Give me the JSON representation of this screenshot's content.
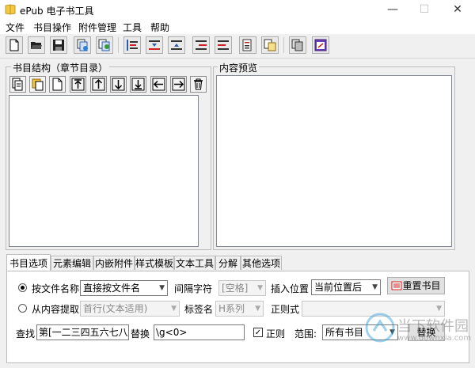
{
  "window": {
    "title": "ePub 电子书工具",
    "minimize": "—",
    "maximize": "☐",
    "close": "✕"
  },
  "menu": [
    "文件",
    "书目操作",
    "附件管理",
    "工具",
    "帮助"
  ],
  "toolbar": {
    "icons": [
      "new-doc-icon",
      "open-folder-icon",
      "save-disk-icon",
      "import-pages-icon",
      "export-pages-icon",
      "list-lines-icon",
      "sort-down-icon",
      "sort-up-icon",
      "indent-icon",
      "outdent-icon",
      "merge-lines-icon",
      "split-pages-icon",
      "copy-pages-icon",
      "settings-window-icon"
    ]
  },
  "toc_panel": {
    "label": "书目结构（章节目录）"
  },
  "preview_panel": {
    "label": "内容预览"
  },
  "tabs": [
    "书目选项",
    "元素编辑",
    "内嵌附件",
    "样式模板",
    "文本工具",
    "分解",
    "其他选项"
  ],
  "options": {
    "by_filename_label": "按文件名称",
    "filename_mode": "直接按文件名",
    "separator_label": "间隔字符",
    "separator_value": "[空格]",
    "insert_pos_label": "插入位置",
    "insert_pos_value": "当前位置后",
    "reset_button": "重置书目",
    "by_content_label": "从内容提取",
    "content_mode": "首行(文本适用)",
    "tag_label": "标签名",
    "tag_value": "H系列",
    "regex_label": "正则式",
    "regex_value": "",
    "find_label": "查找",
    "find_value": "第[一二三四五六七八九",
    "replace_label": "替换",
    "replace_value": "\\g<0>",
    "regex_check_label": "正则",
    "scope_label": "范围:",
    "scope_value": "所有书目",
    "replace_button": "替换"
  },
  "watermark": {
    "brand": "当下软件园",
    "url": "www.downxia.com"
  }
}
